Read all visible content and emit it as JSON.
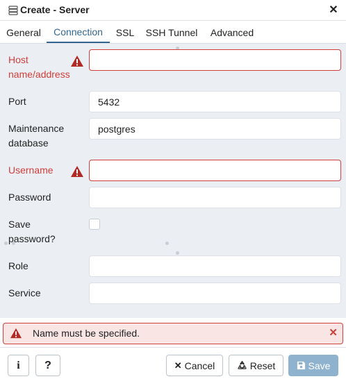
{
  "dialog": {
    "title": "Create - Server",
    "title_icon": "server-icon",
    "close_icon": "close-icon",
    "close_glyph": "✕"
  },
  "tabs": [
    {
      "label": "General",
      "active": false
    },
    {
      "label": "Connection",
      "active": true
    },
    {
      "label": "SSL",
      "active": false
    },
    {
      "label": "SSH Tunnel",
      "active": false
    },
    {
      "label": "Advanced",
      "active": false
    }
  ],
  "form": {
    "host": {
      "label_line1": "Host",
      "label_line2": "name/address",
      "value": "",
      "error": true
    },
    "port": {
      "label": "Port",
      "value": "5432"
    },
    "maintenance_db": {
      "label_line1": "Maintenance",
      "label_line2": "database",
      "value": "postgres"
    },
    "username": {
      "label": "Username",
      "value": "",
      "error": true
    },
    "password": {
      "label": "Password",
      "value": ""
    },
    "save_password": {
      "label_line1": "Save",
      "label_line2": "password?",
      "checked": false
    },
    "role": {
      "label": "Role",
      "value": ""
    },
    "service": {
      "label": "Service",
      "value": ""
    }
  },
  "error_bar": {
    "message": "Name must be specified.",
    "dismiss_glyph": "✕",
    "icon": "warning-icon"
  },
  "footer": {
    "info_glyph": "i",
    "help_glyph": "?",
    "cancel_label": "Cancel",
    "cancel_glyph": "✕",
    "reset_label": "Reset",
    "save_label": "Save"
  },
  "colors": {
    "accent": "#326690",
    "error": "#ce3e3a",
    "form_bg": "#ebeef3",
    "error_bg": "#fae5e5",
    "save_disabled": "#8fb2cf"
  }
}
